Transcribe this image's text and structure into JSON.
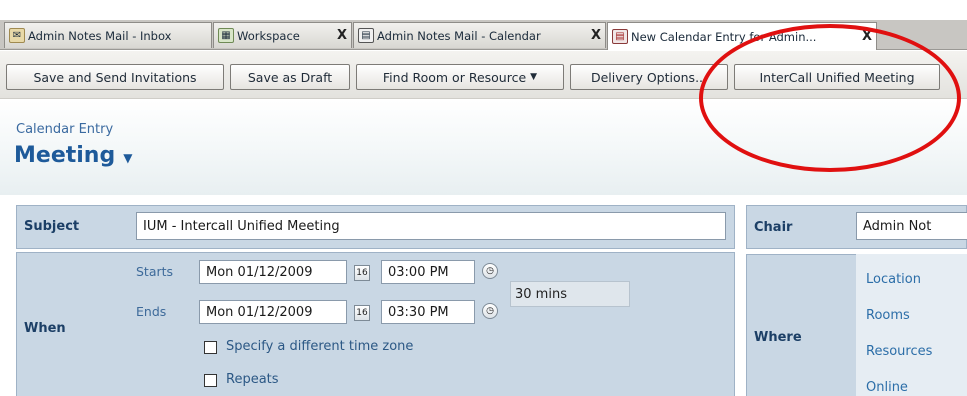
{
  "tabs": [
    {
      "label": "Admin Notes Mail - Inbox",
      "icon": "mail-inbox-icon",
      "closable": false
    },
    {
      "label": "Workspace",
      "icon": "workspace-icon",
      "closable": true
    },
    {
      "label": "Admin Notes Mail - Calendar",
      "icon": "calendar-icon",
      "closable": true
    },
    {
      "label": "New Calendar Entry for Admin...",
      "icon": "calendar-entry-icon",
      "closable": true
    }
  ],
  "tab_close_glyph": "X",
  "toolbar": {
    "save_send_label": "Save and Send Invitations",
    "save_draft_label": "Save as Draft",
    "find_room_label": "Find Room or Resource",
    "delivery_label": "Delivery Options...",
    "intercall_label": "InterCall Unified Meeting"
  },
  "header": {
    "entry_type": "Calendar Entry",
    "title": "Meeting"
  },
  "form": {
    "subject_label": "Subject",
    "subject_value": "IUM - Intercall Unified Meeting",
    "when_label": "When",
    "starts_label": "Starts",
    "start_date": "Mon 01/12/2009",
    "start_time": "03:00 PM",
    "ends_label": "Ends",
    "end_date": "Mon 01/12/2009",
    "end_time": "03:30 PM",
    "duration": "30 mins",
    "timezone_label": "Specify a different time zone",
    "repeats_label": "Repeats",
    "date_picker_glyph": "16",
    "chair_label": "Chair",
    "chair_value": "Admin Not",
    "where_label": "Where",
    "location_link": "Location",
    "rooms_link": "Rooms",
    "resources_link": "Resources",
    "online_link": "Online"
  },
  "colors": {
    "highlight": "#e01010",
    "panel_bg": "#c9d7e4",
    "title_blue": "#1e5a9a"
  }
}
